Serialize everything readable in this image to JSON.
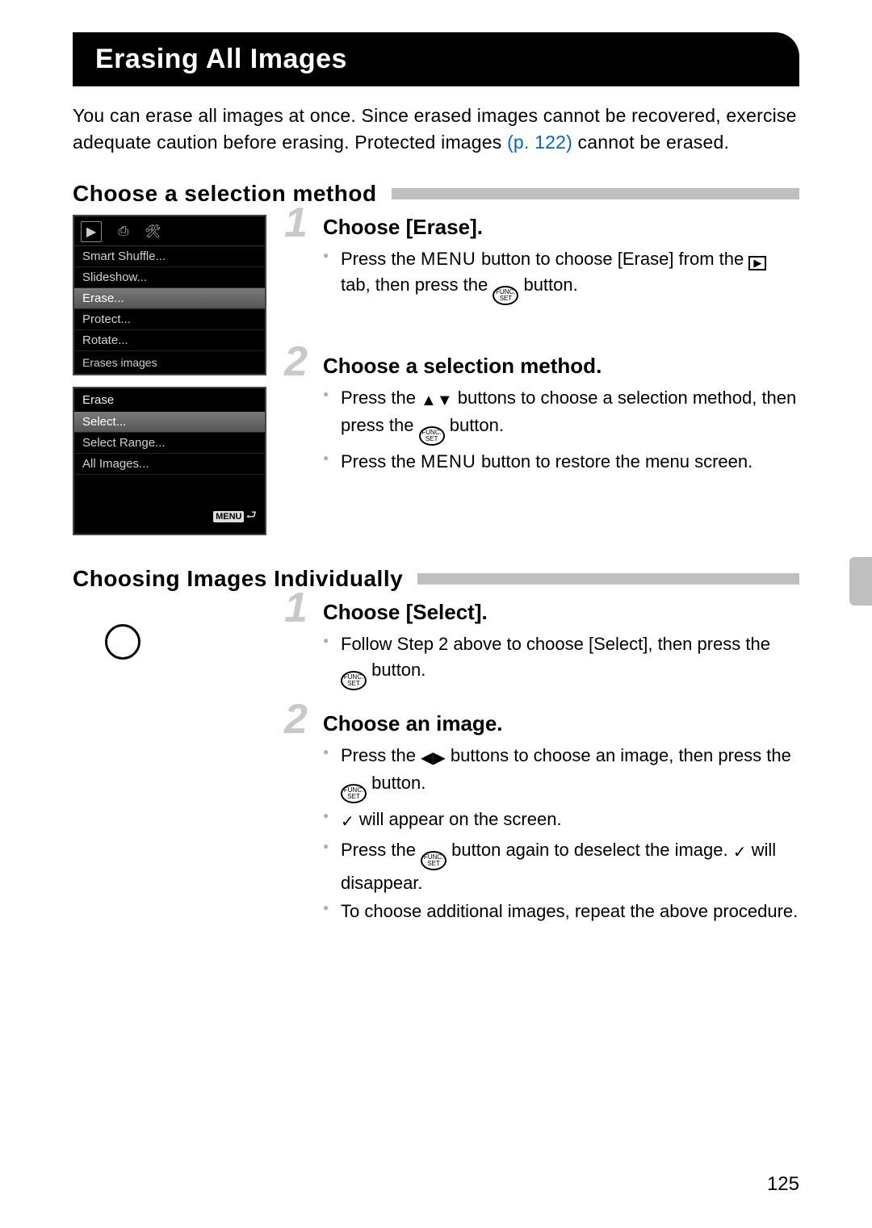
{
  "page_number": "125",
  "title": "Erasing All Images",
  "intro": {
    "t1": "You can erase all images at once. Since erased images cannot be recovered, exercise adequate caution before erasing. Protected images ",
    "link": "(p. 122)",
    "t2": " cannot be erased."
  },
  "section1": {
    "heading": "Choose a selection method",
    "lcd1": {
      "items": [
        "Smart Shuffle...",
        "Slideshow...",
        "Erase...",
        "Protect...",
        "Rotate..."
      ],
      "selected_index": 2,
      "status": "Erases images"
    },
    "lcd2": {
      "title": "Erase",
      "items": [
        "Select...",
        "Select Range...",
        "All Images..."
      ],
      "selected_index": 0,
      "return": "MENU"
    },
    "step1": {
      "num": "1",
      "title": "Choose [Erase].",
      "b1a": "Press the ",
      "b1_menu": "MENU",
      "b1b": " button to choose [Erase] from the ",
      "b1c": " tab, then press the ",
      "b1d": " button."
    },
    "step2": {
      "num": "2",
      "title": "Choose a selection method.",
      "b1a": "Press the ",
      "b1b": " buttons to choose a selection method, then press the ",
      "b1c": " button.",
      "b2a": "Press the ",
      "b2_menu": "MENU",
      "b2b": " button to restore the menu screen."
    }
  },
  "section2": {
    "heading": "Choosing Images Individually",
    "step1": {
      "num": "1",
      "title": "Choose [Select].",
      "b1a": "Follow Step 2 above to choose [Select], then press the ",
      "b1b": " button."
    },
    "step2": {
      "num": "2",
      "title": "Choose an image.",
      "b1a": "Press the ",
      "b1b": " buttons to choose an image, then press the ",
      "b1c": " button.",
      "b2a": " will appear on the screen.",
      "b3a": "Press the ",
      "b3b": " button again to deselect the image. ",
      "b3c": " will disappear.",
      "b4": "To choose additional images, repeat the above procedure."
    }
  },
  "funcset": {
    "top": "FUNC.",
    "bot": "SET"
  }
}
